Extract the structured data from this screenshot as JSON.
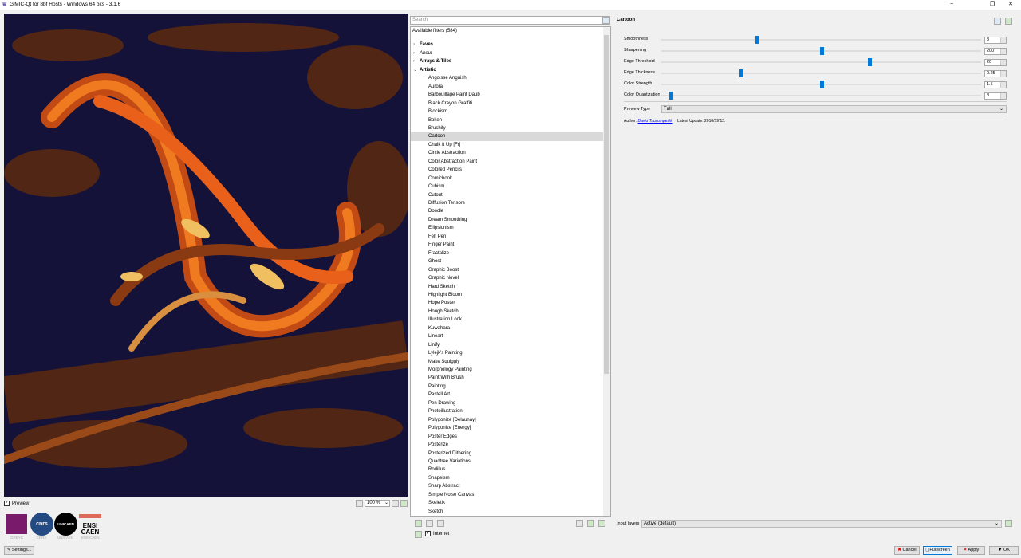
{
  "window": {
    "title": "G'MIC-Qt for 8bf Hosts - Windows 64 bits - 3.1.6",
    "minimize": "−",
    "maximize": "❐",
    "close": "✕"
  },
  "preview": {
    "checkbox_label": "Preview",
    "checked": true,
    "zoom": "100 %"
  },
  "logos": [
    {
      "name": "GREYC",
      "label": "GREYC"
    },
    {
      "name": "CNRS",
      "text": "cnrs",
      "label": "CNRS"
    },
    {
      "name": "UNICAEN",
      "text": "UNICAEN",
      "label": "UNICAEN"
    },
    {
      "name": "ENSICAEN",
      "text": "ENSI CAEN",
      "label": "ENSICAEN"
    }
  ],
  "settings_label": "Settings...",
  "filters": {
    "search_placeholder": "Search",
    "header": "Available filters (584)",
    "categories": [
      {
        "label": "Faves",
        "style": "bold",
        "expanded": false
      },
      {
        "label": "About",
        "style": "italic",
        "expanded": false
      },
      {
        "label": "Arrays & Tiles",
        "style": "bold",
        "expanded": false
      },
      {
        "label": "Artistic",
        "style": "bold",
        "expanded": true
      }
    ],
    "items": [
      "Angoisse Anguish",
      "Aurora",
      "Barbouillage Paint Daub",
      "Black Crayon Graffiti",
      "Blockism",
      "Bokeh",
      "Brushify",
      "Cartoon",
      "Chalk It Up [Fr]",
      "Circle Abstraction",
      "Color Abstraction Paint",
      "Colored Pencils",
      "Comicbook",
      "Cubism",
      "Cutout",
      "Diffusion Tensors",
      "Doodle",
      "Dream Smoothing",
      "Ellipsionism",
      "Felt Pen",
      "Finger Paint",
      "Fractalize",
      "Ghost",
      "Graphic Boost",
      "Graphic Novel",
      "Hard Sketch",
      "Highlight Bloom",
      "Hope Poster",
      "Hough Sketch",
      "Illustration Look",
      "Kuwahara",
      "Lineart",
      "Linify",
      "Lylejk's Painting",
      "Make Squiggly",
      "Morphology Painting",
      "Paint With Brush",
      "Painting",
      "Pastell Art",
      "Pen Drawing",
      "Photoillustration",
      "Polygonize [Delaunay]",
      "Polygonize [Energy]",
      "Poster Edges",
      "Posterize",
      "Posterized Dithering",
      "Quadtree Variations",
      "Rodilius",
      "Shapeism",
      "Sharp Abstract",
      "Simple Noise Canvas",
      "Skeletik",
      "Sketch"
    ],
    "selected": "Cartoon",
    "internet_label": "Internet",
    "internet_checked": true
  },
  "filter": {
    "title": "Cartoon",
    "params": [
      {
        "label": "Smoothness",
        "value": "3",
        "position": 0.3
      },
      {
        "label": "Sharpening",
        "value": "200",
        "position": 0.5
      },
      {
        "label": "Edge Threshold",
        "value": "20",
        "position": 0.65
      },
      {
        "label": "Edge Thickness",
        "value": "0.25",
        "position": 0.25
      },
      {
        "label": "Color Strength",
        "value": "1.5",
        "position": 0.5
      },
      {
        "label": "Color Quantization",
        "value": "8",
        "position": 0.03
      }
    ],
    "preview_type_label": "Preview Type",
    "preview_type": "Full",
    "author_label": "Author:",
    "author": "David Tschumperlé.",
    "update_label": "Latest Update:",
    "update": "2010/29/12."
  },
  "input_layers": {
    "label": "Input layers",
    "value": "Active (default)"
  },
  "buttons": {
    "cancel": "Cancel",
    "fullscreen": "Fullscreen",
    "apply": "Apply",
    "ok": "OK"
  },
  "colors": {
    "accent": "#0078d7",
    "selection": "#d9d9d9",
    "preview_bg": "#15123a"
  }
}
